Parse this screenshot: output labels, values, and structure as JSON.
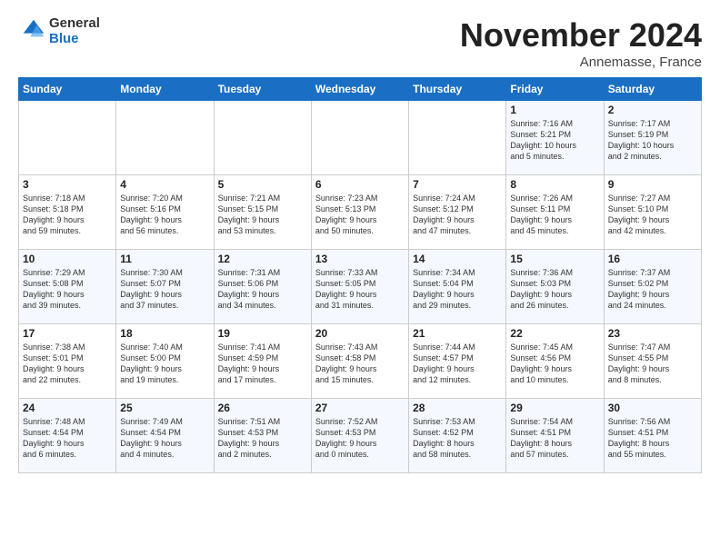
{
  "header": {
    "logo_line1": "General",
    "logo_line2": "Blue",
    "month": "November 2024",
    "location": "Annemasse, France"
  },
  "weekdays": [
    "Sunday",
    "Monday",
    "Tuesday",
    "Wednesday",
    "Thursday",
    "Friday",
    "Saturday"
  ],
  "weeks": [
    [
      {
        "day": "",
        "info": ""
      },
      {
        "day": "",
        "info": ""
      },
      {
        "day": "",
        "info": ""
      },
      {
        "day": "",
        "info": ""
      },
      {
        "day": "",
        "info": ""
      },
      {
        "day": "1",
        "info": "Sunrise: 7:16 AM\nSunset: 5:21 PM\nDaylight: 10 hours\nand 5 minutes."
      },
      {
        "day": "2",
        "info": "Sunrise: 7:17 AM\nSunset: 5:19 PM\nDaylight: 10 hours\nand 2 minutes."
      }
    ],
    [
      {
        "day": "3",
        "info": "Sunrise: 7:18 AM\nSunset: 5:18 PM\nDaylight: 9 hours\nand 59 minutes."
      },
      {
        "day": "4",
        "info": "Sunrise: 7:20 AM\nSunset: 5:16 PM\nDaylight: 9 hours\nand 56 minutes."
      },
      {
        "day": "5",
        "info": "Sunrise: 7:21 AM\nSunset: 5:15 PM\nDaylight: 9 hours\nand 53 minutes."
      },
      {
        "day": "6",
        "info": "Sunrise: 7:23 AM\nSunset: 5:13 PM\nDaylight: 9 hours\nand 50 minutes."
      },
      {
        "day": "7",
        "info": "Sunrise: 7:24 AM\nSunset: 5:12 PM\nDaylight: 9 hours\nand 47 minutes."
      },
      {
        "day": "8",
        "info": "Sunrise: 7:26 AM\nSunset: 5:11 PM\nDaylight: 9 hours\nand 45 minutes."
      },
      {
        "day": "9",
        "info": "Sunrise: 7:27 AM\nSunset: 5:10 PM\nDaylight: 9 hours\nand 42 minutes."
      }
    ],
    [
      {
        "day": "10",
        "info": "Sunrise: 7:29 AM\nSunset: 5:08 PM\nDaylight: 9 hours\nand 39 minutes."
      },
      {
        "day": "11",
        "info": "Sunrise: 7:30 AM\nSunset: 5:07 PM\nDaylight: 9 hours\nand 37 minutes."
      },
      {
        "day": "12",
        "info": "Sunrise: 7:31 AM\nSunset: 5:06 PM\nDaylight: 9 hours\nand 34 minutes."
      },
      {
        "day": "13",
        "info": "Sunrise: 7:33 AM\nSunset: 5:05 PM\nDaylight: 9 hours\nand 31 minutes."
      },
      {
        "day": "14",
        "info": "Sunrise: 7:34 AM\nSunset: 5:04 PM\nDaylight: 9 hours\nand 29 minutes."
      },
      {
        "day": "15",
        "info": "Sunrise: 7:36 AM\nSunset: 5:03 PM\nDaylight: 9 hours\nand 26 minutes."
      },
      {
        "day": "16",
        "info": "Sunrise: 7:37 AM\nSunset: 5:02 PM\nDaylight: 9 hours\nand 24 minutes."
      }
    ],
    [
      {
        "day": "17",
        "info": "Sunrise: 7:38 AM\nSunset: 5:01 PM\nDaylight: 9 hours\nand 22 minutes."
      },
      {
        "day": "18",
        "info": "Sunrise: 7:40 AM\nSunset: 5:00 PM\nDaylight: 9 hours\nand 19 minutes."
      },
      {
        "day": "19",
        "info": "Sunrise: 7:41 AM\nSunset: 4:59 PM\nDaylight: 9 hours\nand 17 minutes."
      },
      {
        "day": "20",
        "info": "Sunrise: 7:43 AM\nSunset: 4:58 PM\nDaylight: 9 hours\nand 15 minutes."
      },
      {
        "day": "21",
        "info": "Sunrise: 7:44 AM\nSunset: 4:57 PM\nDaylight: 9 hours\nand 12 minutes."
      },
      {
        "day": "22",
        "info": "Sunrise: 7:45 AM\nSunset: 4:56 PM\nDaylight: 9 hours\nand 10 minutes."
      },
      {
        "day": "23",
        "info": "Sunrise: 7:47 AM\nSunset: 4:55 PM\nDaylight: 9 hours\nand 8 minutes."
      }
    ],
    [
      {
        "day": "24",
        "info": "Sunrise: 7:48 AM\nSunset: 4:54 PM\nDaylight: 9 hours\nand 6 minutes."
      },
      {
        "day": "25",
        "info": "Sunrise: 7:49 AM\nSunset: 4:54 PM\nDaylight: 9 hours\nand 4 minutes."
      },
      {
        "day": "26",
        "info": "Sunrise: 7:51 AM\nSunset: 4:53 PM\nDaylight: 9 hours\nand 2 minutes."
      },
      {
        "day": "27",
        "info": "Sunrise: 7:52 AM\nSunset: 4:53 PM\nDaylight: 9 hours\nand 0 minutes."
      },
      {
        "day": "28",
        "info": "Sunrise: 7:53 AM\nSunset: 4:52 PM\nDaylight: 8 hours\nand 58 minutes."
      },
      {
        "day": "29",
        "info": "Sunrise: 7:54 AM\nSunset: 4:51 PM\nDaylight: 8 hours\nand 57 minutes."
      },
      {
        "day": "30",
        "info": "Sunrise: 7:56 AM\nSunset: 4:51 PM\nDaylight: 8 hours\nand 55 minutes."
      }
    ]
  ]
}
